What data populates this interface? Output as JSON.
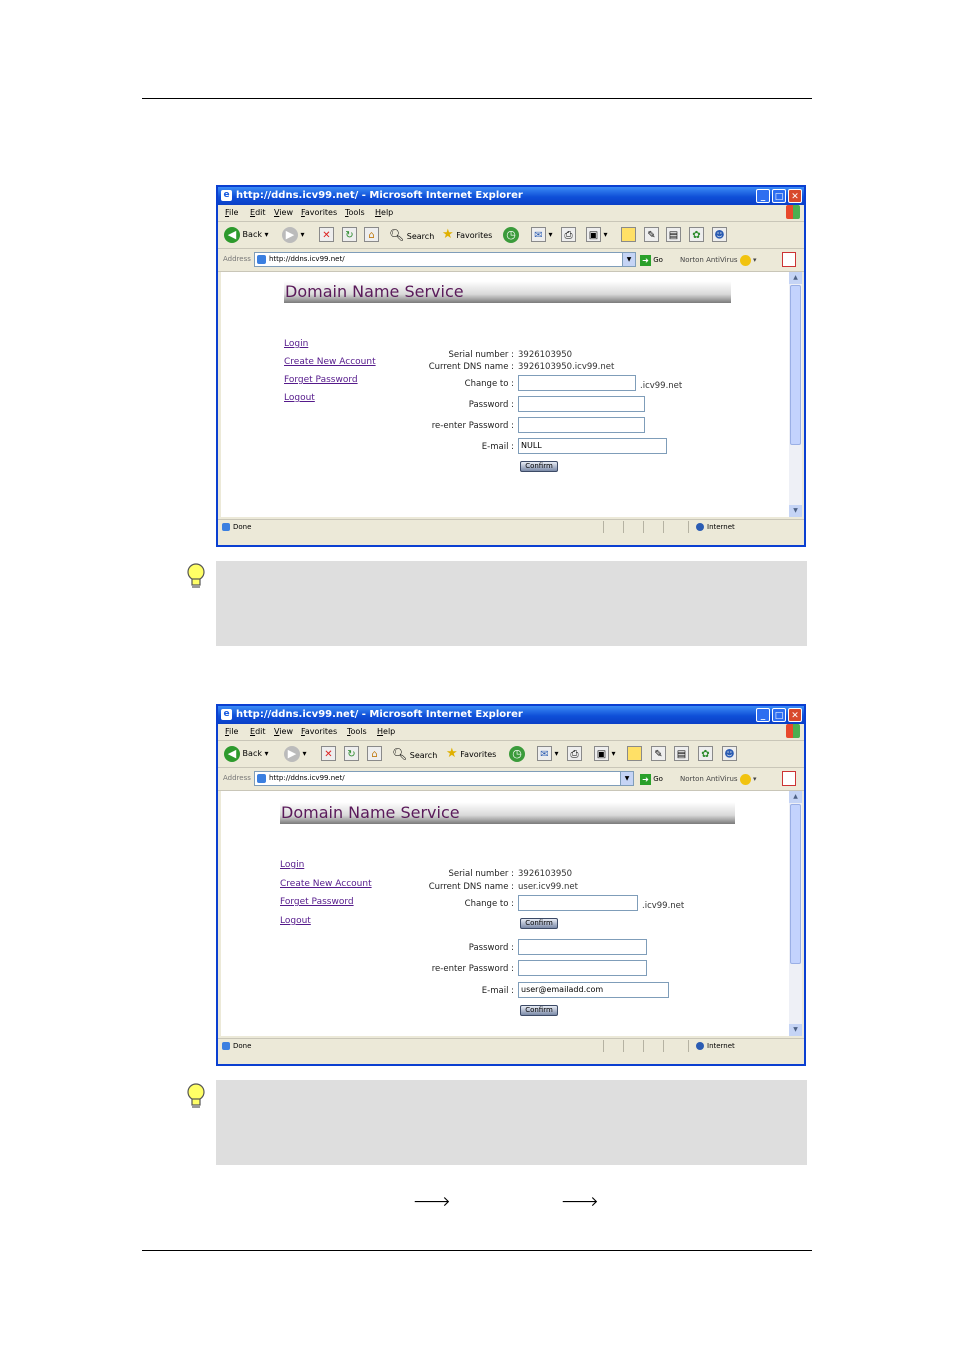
{
  "browser": {
    "title": "http://ddns.icv99.net/ - Microsoft Internet Explorer",
    "menu": [
      "File",
      "Edit",
      "View",
      "Favorites",
      "Tools",
      "Help"
    ],
    "toolbar": {
      "back": "Back",
      "search": "Search",
      "favorites": "Favorites"
    },
    "address_label": "Address",
    "url": "http://ddns.icv99.net/",
    "go": "Go",
    "norton": "Norton AntiVirus",
    "status_done": "Done",
    "status_zone": "Internet"
  },
  "page": {
    "banner": "Domain Name Service",
    "nav": [
      "Login",
      "Create New Account",
      "Forget Password",
      "Logout"
    ],
    "labels": {
      "serial": "Serial number :",
      "current_dns": "Current DNS name :",
      "change_to": "Change to :",
      "password": "Password :",
      "reenter": "re-enter Password :",
      "email": "E-mail :"
    },
    "confirm": "Confirm",
    "suffix": ".icv99.net"
  },
  "screenshot1": {
    "serial_value": "3926103950",
    "current_dns_value": "3926103950.icv99.net",
    "change_to_value": "",
    "email_value": "NULL"
  },
  "screenshot2": {
    "serial_value": "3926103950",
    "current_dns_value": "user.icv99.net",
    "change_to_value": "",
    "email_value": "user@emailadd.com"
  },
  "bottom_arrows": [
    "🡒",
    "🡒"
  ],
  "colors": {
    "note_bg": "#dedede",
    "titlebar": "#0a3fd1",
    "link": "#551a8b"
  }
}
